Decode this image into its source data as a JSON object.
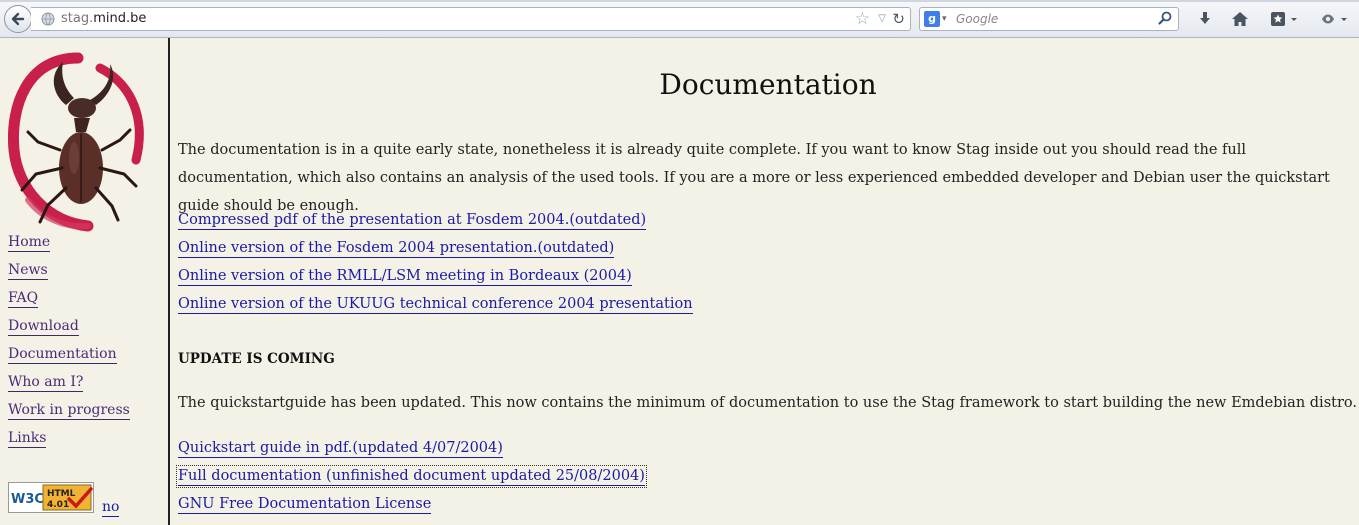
{
  "browser": {
    "url_prefix": "stag.",
    "url_host": "mind.be",
    "search_placeholder": "Google",
    "search_engine_letter": "g"
  },
  "sidebar": {
    "nav": [
      {
        "label": "Home"
      },
      {
        "label": "News"
      },
      {
        "label": "FAQ"
      },
      {
        "label": "Download"
      },
      {
        "label": "Documentation"
      },
      {
        "label": "Who am I?"
      },
      {
        "label": "Work in progress"
      },
      {
        "label": "Links"
      }
    ],
    "badge": {
      "w3c": "W3C",
      "line1": "HTML",
      "line2": "4.01"
    },
    "badge_link": "no"
  },
  "main": {
    "title": "Documentation",
    "intro": "The documentation is in a quite early state, nonetheless it is already quite complete. If you want to know Stag inside out you should read the full documentation, which also contains an analysis of the used tools. If you are a more or less experienced embedded developer and Debian user the quickstart guide should be enough.",
    "links": [
      "Compressed pdf of the presentation at Fosdem 2004.(outdated)",
      "Online version of the Fosdem 2004 presentation.(outdated)",
      "Online version of the RMLL/LSM meeting in Bordeaux (2004)",
      "Online version of the UKUUG technical conference 2004 presentation"
    ],
    "update_heading": "UPDATE IS COMING",
    "update_text": "The quickstartguide has been updated. This now contains the minimum of documentation to use the Stag framework to start building the new Emdebian distro.",
    "update_links": [
      "Quickstart guide in pdf.(updated 4/07/2004)",
      "Full documentation (unfinished document updated 25/08/2004)",
      "GNU Free Documentation License"
    ]
  },
  "colors": {
    "page_bg": "#f4f1e6",
    "link": "#1a1aa6",
    "nav_link": "#4b2a7a",
    "logo_circle": "#c8204a"
  }
}
